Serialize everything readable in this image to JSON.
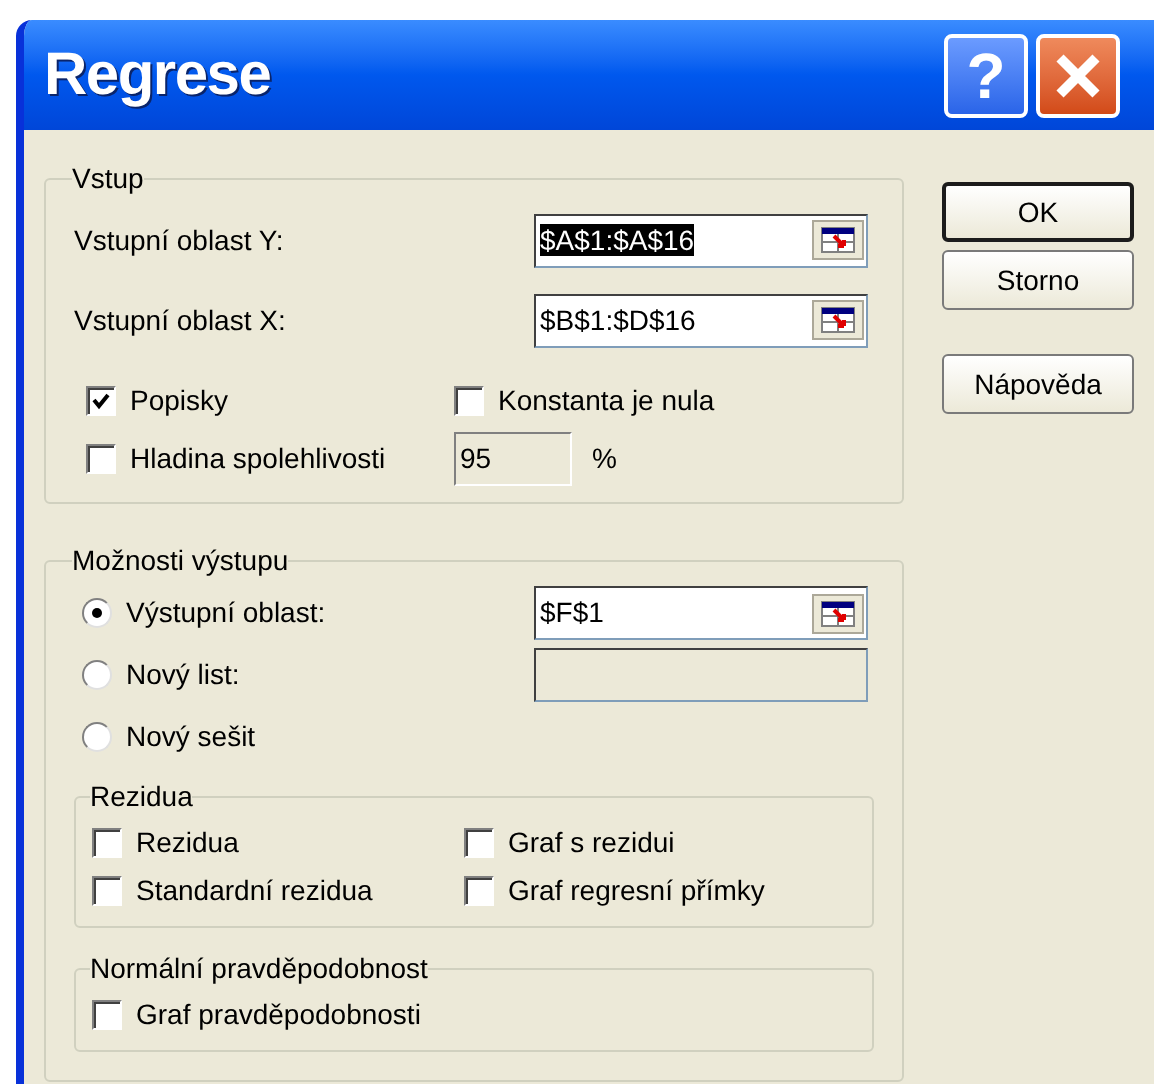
{
  "window": {
    "title": "Regrese",
    "help_button": "?"
  },
  "input_group": {
    "title": "Vstup",
    "ranges": [
      {
        "label": "Vstupní oblast Y:",
        "value": "$A$1:$A$16",
        "selected": true
      },
      {
        "label": "Vstupní oblast X:",
        "value": "$B$1:$D$16",
        "selected": false
      }
    ],
    "options": [
      {
        "label": "Popisky",
        "checked": true
      },
      {
        "label": "Konstanta je nula",
        "checked": false
      }
    ],
    "confidence": {
      "label": "Hladina spolehlivosti",
      "checked": false,
      "value": "95",
      "unit": "%",
      "disabled": true
    }
  },
  "buttons": [
    {
      "label": "OK",
      "default": true
    },
    {
      "label": "Storno",
      "default": false
    },
    {
      "label": "Nápověda",
      "default": false
    }
  ],
  "output_group": {
    "title": "Možnosti výstupu",
    "destinations": [
      {
        "label": "Výstupní oblast:",
        "selected": true,
        "field": {
          "value": "$F$1",
          "disabled": false
        }
      },
      {
        "label": "Nový list:",
        "selected": false,
        "field": {
          "disabled": true
        }
      },
      {
        "label": "Nový sešit",
        "selected": false
      }
    ],
    "residuals": {
      "title": "Rezidua",
      "options": [
        {
          "label": "Rezidua",
          "checked": false
        },
        {
          "label": "Graf s rezidui",
          "checked": false
        },
        {
          "label": "Standardní rezidua",
          "checked": false
        },
        {
          "label": "Graf regresní přímky",
          "checked": false
        }
      ]
    },
    "normal_probability": {
      "title": "Normální pravděpodobnost",
      "options": [
        {
          "label": "Graf pravděpodobnosti",
          "checked": false
        }
      ]
    }
  }
}
